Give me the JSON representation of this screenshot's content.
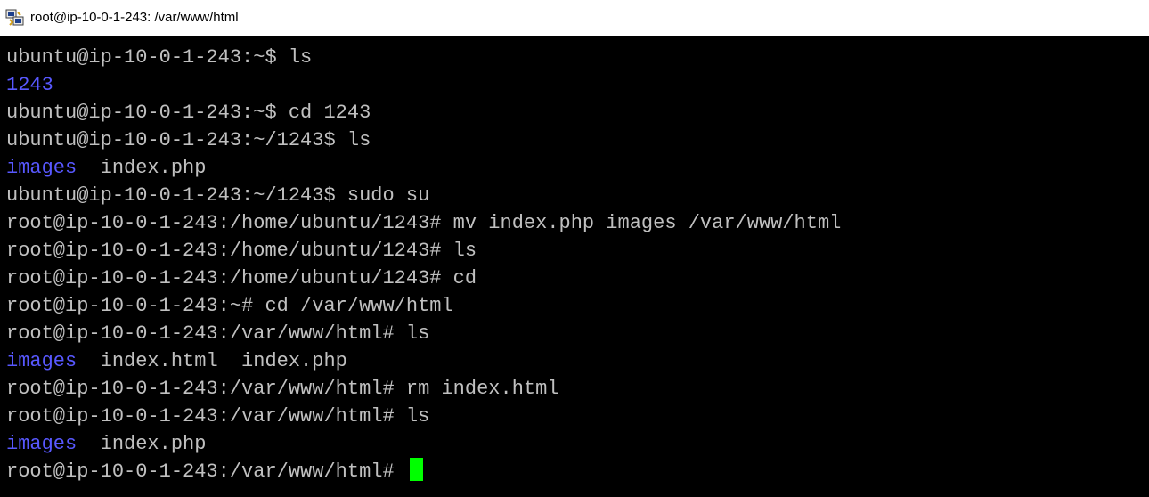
{
  "window": {
    "title": "root@ip-10-0-1-243: /var/www/html",
    "icon": "putty-icon"
  },
  "terminal": {
    "colors": {
      "background": "#000000",
      "text": "#c0c0c0",
      "directory": "#5858ff",
      "cursor": "#00ff00"
    },
    "lines": {
      "l0": "ubuntu@ip-10-0-1-243:~$ ls",
      "l1": "1243",
      "l2": "ubuntu@ip-10-0-1-243:~$ cd 1243",
      "l3": "ubuntu@ip-10-0-1-243:~/1243$ ls",
      "l4_dir": "images",
      "l4_rest": "  index.php",
      "l5": "ubuntu@ip-10-0-1-243:~/1243$ sudo su",
      "l6": "root@ip-10-0-1-243:/home/ubuntu/1243# mv index.php images /var/www/html",
      "l7": "root@ip-10-0-1-243:/home/ubuntu/1243# ls",
      "l8": "root@ip-10-0-1-243:/home/ubuntu/1243# cd",
      "l9": "root@ip-10-0-1-243:~# cd /var/www/html",
      "l10": "root@ip-10-0-1-243:/var/www/html# ls",
      "l11_dir": "images",
      "l11_rest": "  index.html  index.php",
      "l12": "root@ip-10-0-1-243:/var/www/html# rm index.html",
      "l13": "root@ip-10-0-1-243:/var/www/html# ls",
      "l14_dir": "images",
      "l14_rest": "  index.php",
      "l15_prompt": "root@ip-10-0-1-243:/var/www/html# "
    }
  }
}
